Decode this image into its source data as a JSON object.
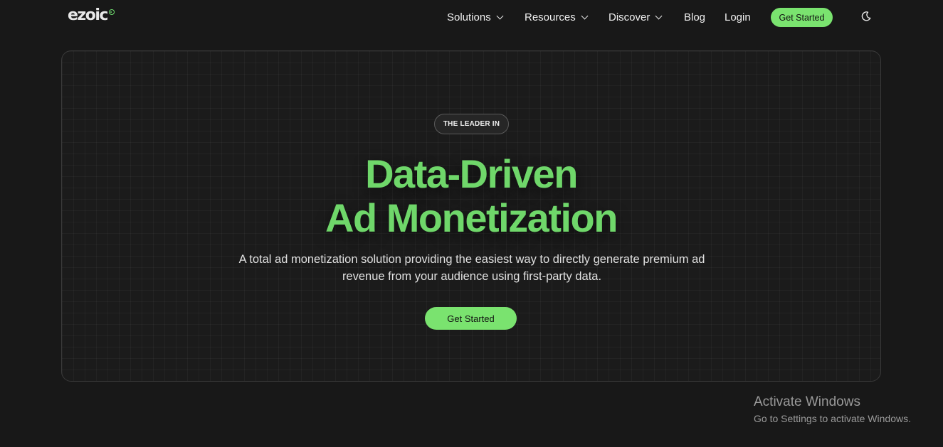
{
  "header": {
    "logo_text": "ezoic",
    "nav": [
      {
        "label": "Solutions",
        "has_dropdown": true
      },
      {
        "label": "Resources",
        "has_dropdown": true
      },
      {
        "label": "Discover",
        "has_dropdown": true
      },
      {
        "label": "Blog",
        "has_dropdown": false
      },
      {
        "label": "Login",
        "has_dropdown": false
      }
    ],
    "cta_label": "Get Started",
    "theme_toggle_icon": "moon-icon"
  },
  "hero": {
    "badge": "THE LEADER IN",
    "headline_line1": "Data-Driven",
    "headline_line2": "Ad Monetization",
    "subtext": "A total ad monetization solution providing the easiest way to directly generate premium ad revenue from your audience using first-party data.",
    "cta_label": "Get Started"
  },
  "watermark": {
    "title": "Activate Windows",
    "subtitle": "Go to Settings to activate Windows."
  },
  "colors": {
    "background": "#181818",
    "accent_green": "#7ae36f",
    "headline_green": "#6fd76a",
    "card_border": "#3a3a3a"
  }
}
